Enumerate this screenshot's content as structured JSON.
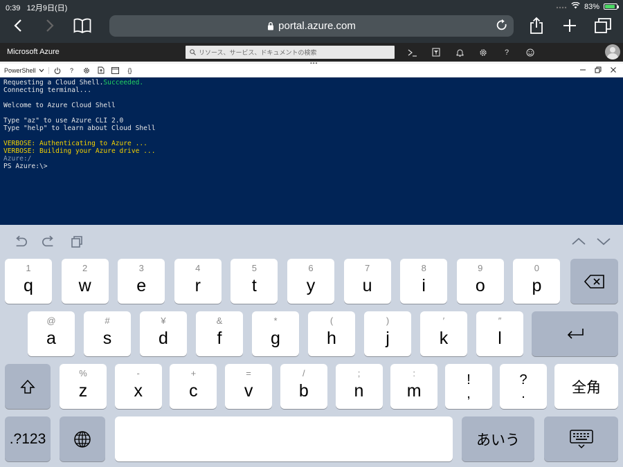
{
  "status_bar": {
    "time": "0:39",
    "date": "12月9日(日)",
    "battery": "83%"
  },
  "browser": {
    "url": "portal.azure.com"
  },
  "azure": {
    "brand": "Microsoft Azure",
    "search_placeholder": "リソース、サービス、ドキュメントの検索",
    "top_icons": [
      "cloud-shell-icon",
      "directory-filter-icon",
      "bell-icon",
      "gear-icon",
      "help-icon",
      "smiley-icon"
    ]
  },
  "shell": {
    "selector": "PowerShell",
    "toolbar_icons": [
      "power-icon",
      "help-icon",
      "gear-icon",
      "upload-icon",
      "open-editor-icon",
      "braces-icon"
    ]
  },
  "terminal": {
    "line1_prefix": "Requesting a Cloud Shell.",
    "line1_status": "Succeeded.",
    "line2": "Connecting terminal...",
    "line3": "Welcome to Azure Cloud Shell",
    "line4": "Type \"az\" to use Azure CLI 2.0",
    "line5": "Type \"help\" to learn about Cloud Shell",
    "line6": "VERBOSE: Authenticating to Azure ...",
    "line7": "VERBOSE: Building your Azure drive ...",
    "line8": "Azure:/",
    "line9": "PS Azure:\\>"
  },
  "keyboard": {
    "row1": [
      {
        "hint": "1",
        "key": "q"
      },
      {
        "hint": "2",
        "key": "w"
      },
      {
        "hint": "3",
        "key": "e"
      },
      {
        "hint": "4",
        "key": "r"
      },
      {
        "hint": "5",
        "key": "t"
      },
      {
        "hint": "6",
        "key": "y"
      },
      {
        "hint": "7",
        "key": "u"
      },
      {
        "hint": "8",
        "key": "i"
      },
      {
        "hint": "9",
        "key": "o"
      },
      {
        "hint": "0",
        "key": "p"
      }
    ],
    "row2": [
      {
        "hint": "@",
        "key": "a"
      },
      {
        "hint": "#",
        "key": "s"
      },
      {
        "hint": "¥",
        "key": "d"
      },
      {
        "hint": "&",
        "key": "f"
      },
      {
        "hint": "*",
        "key": "g"
      },
      {
        "hint": "(",
        "key": "h"
      },
      {
        "hint": ")",
        "key": "j"
      },
      {
        "hint": "′",
        "key": "k"
      },
      {
        "hint": "″",
        "key": "l"
      }
    ],
    "row3": [
      {
        "hint": "%",
        "key": "z"
      },
      {
        "hint": "-",
        "key": "x"
      },
      {
        "hint": "+",
        "key": "c"
      },
      {
        "hint": "=",
        "key": "v"
      },
      {
        "hint": "/",
        "key": "b"
      },
      {
        "hint": ";",
        "key": "n"
      },
      {
        "hint": ":",
        "key": "m"
      }
    ],
    "punct1": {
      "top": "!",
      "bottom": ","
    },
    "punct2": {
      "top": "?",
      "bottom": "."
    },
    "zenkaku": "全角",
    "numbers": ".?123",
    "kana": "あいう"
  }
}
